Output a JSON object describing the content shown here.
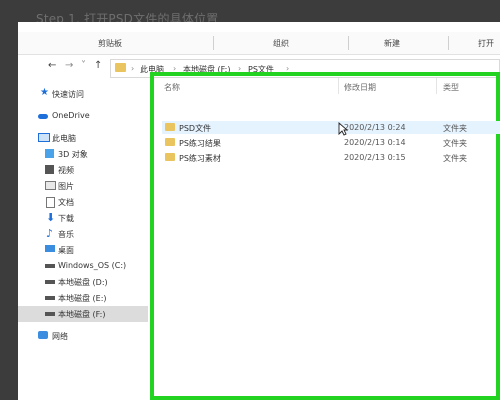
{
  "caption": "Step 1. 打开PSD文件的具体位置",
  "ribbon": {
    "clipboard": "剪贴板",
    "organize": "组织",
    "new": "新建",
    "open": "打开"
  },
  "address": {
    "back_icon": "←",
    "forward_icon": "→",
    "recent_icon": "˅",
    "up_icon": "↑",
    "path": [
      "此电脑",
      "本地磁盘 (F:)",
      "PS文件"
    ]
  },
  "sidebar": {
    "items": [
      {
        "label": "快速访问",
        "icon": "star-icon"
      },
      {
        "label": "OneDrive",
        "icon": "cloud-icon"
      },
      {
        "label": "此电脑",
        "icon": "computer-icon"
      },
      {
        "label": "3D 对象",
        "icon": "cube-icon"
      },
      {
        "label": "视频",
        "icon": "video-icon"
      },
      {
        "label": "图片",
        "icon": "picture-icon"
      },
      {
        "label": "文档",
        "icon": "document-icon"
      },
      {
        "label": "下载",
        "icon": "download-icon"
      },
      {
        "label": "音乐",
        "icon": "music-icon"
      },
      {
        "label": "桌面",
        "icon": "desktop-icon"
      },
      {
        "label": "Windows_OS (C:)",
        "icon": "drive-icon"
      },
      {
        "label": "本地磁盘 (D:)",
        "icon": "drive-icon"
      },
      {
        "label": "本地磁盘 (E:)",
        "icon": "drive-icon"
      },
      {
        "label": "本地磁盘 (F:)",
        "icon": "drive-icon"
      },
      {
        "label": "网络",
        "icon": "network-icon"
      }
    ],
    "selected": "本地磁盘 (F:)"
  },
  "columns": {
    "name": "名称",
    "date": "修改日期",
    "type": "类型"
  },
  "files": [
    {
      "name": "PSD文件",
      "date": "2020/2/13 0:24",
      "type": "文件夹"
    },
    {
      "name": "PS练习结果",
      "date": "2020/2/13 0:14",
      "type": "文件夹"
    },
    {
      "name": "PS练习素材",
      "date": "2020/2/13 0:15",
      "type": "文件夹"
    }
  ],
  "colors": {
    "highlight_border": "#22d322",
    "folder": "#e9c45f",
    "row_hover": "#e5f3ff",
    "link_blue": "#1e6fd9"
  }
}
